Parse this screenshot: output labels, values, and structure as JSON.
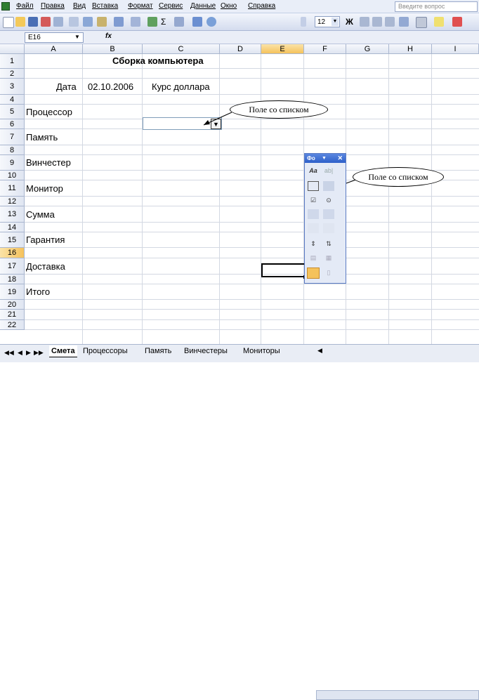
{
  "menu": [
    "Файл",
    "Правка",
    "Вид",
    "Вставка",
    "Формат",
    "Сервис",
    "Данные",
    "Окно",
    "Справка"
  ],
  "ask_placeholder": "Введите вопрос",
  "toolbar": {
    "font_size": "12"
  },
  "formula_bar": {
    "name_box": "E16",
    "fx": "fx",
    "content": ""
  },
  "columns": [
    "A",
    "B",
    "C",
    "D",
    "E",
    "F",
    "G",
    "H",
    "I"
  ],
  "selected_column": "E",
  "rows": [
    "1",
    "2",
    "3",
    "4",
    "5",
    "6",
    "7",
    "8",
    "9",
    "10",
    "11",
    "12",
    "13",
    "14",
    "15",
    "16",
    "17",
    "18",
    "19",
    "20",
    "21",
    "22"
  ],
  "selected_row": "16",
  "cells": {
    "title": "Сборка компьютера",
    "date_label": "Дата",
    "date_value": "02.10.2006",
    "rate_label": "Курс доллара",
    "processor": "Процессор",
    "memory": "Память",
    "hdd": "Винчестер",
    "monitor": "Монитор",
    "sum": "Сумма",
    "warranty": "Гарантия",
    "delivery": "Доставка",
    "total": "Итого"
  },
  "callouts": {
    "left": "Поле со списком",
    "right": "Поле со списком"
  },
  "forms_toolbar": {
    "title": "Фо"
  },
  "sheet_tabs": [
    "Смета",
    "Процессоры",
    "Память",
    "Винчестеры",
    "Мониторы"
  ],
  "active_tab": "Смета"
}
